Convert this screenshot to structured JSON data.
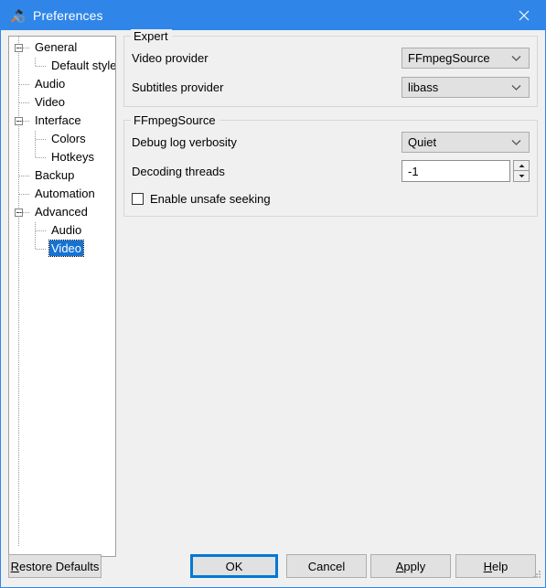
{
  "window": {
    "title": "Preferences",
    "icon": "hammer-wrench-icon",
    "close_label": "✕",
    "titlebar_color": "#2f86e8",
    "background_color": "#f0f0f0",
    "accent_color": "#0078d7",
    "selection_color": "#1673d4"
  },
  "sidebar": {
    "items": [
      {
        "label": "General",
        "level": 0,
        "expander": "collapse-minus",
        "selected": false
      },
      {
        "label": "Default styles",
        "level": 1,
        "expander": "none",
        "selected": false
      },
      {
        "label": "Audio",
        "level": 0,
        "expander": "none",
        "selected": false
      },
      {
        "label": "Video",
        "level": 0,
        "expander": "none",
        "selected": false
      },
      {
        "label": "Interface",
        "level": 0,
        "expander": "collapse-minus",
        "selected": false
      },
      {
        "label": "Colors",
        "level": 1,
        "expander": "none",
        "selected": false
      },
      {
        "label": "Hotkeys",
        "level": 1,
        "expander": "none",
        "selected": false
      },
      {
        "label": "Backup",
        "level": 0,
        "expander": "none",
        "selected": false
      },
      {
        "label": "Automation",
        "level": 0,
        "expander": "none",
        "selected": false
      },
      {
        "label": "Advanced",
        "level": 0,
        "expander": "collapse-minus",
        "selected": false
      },
      {
        "label": "Audio",
        "level": 1,
        "expander": "none",
        "selected": false
      },
      {
        "label": "Video",
        "level": 1,
        "expander": "none",
        "selected": true
      }
    ]
  },
  "main": {
    "groups": [
      {
        "title": "Expert",
        "rows": [
          {
            "label": "Video provider",
            "control": "combo",
            "value": "FFmpegSource"
          },
          {
            "label": "Subtitles provider",
            "control": "combo",
            "value": "libass"
          }
        ]
      },
      {
        "title": "FFmpegSource",
        "rows": [
          {
            "label": "Debug log verbosity",
            "control": "combo",
            "value": "Quiet"
          },
          {
            "label": "Decoding threads",
            "control": "spinner",
            "value": "-1"
          }
        ],
        "checkbox": {
          "label": "Enable unsafe seeking",
          "checked": false
        }
      }
    ]
  },
  "footer": {
    "buttons": [
      {
        "id": "restore",
        "label": "Restore Defaults",
        "mnemonic": "R",
        "default": false
      },
      {
        "id": "ok",
        "label": "OK",
        "mnemonic": "",
        "default": true
      },
      {
        "id": "cancel",
        "label": "Cancel",
        "mnemonic": "",
        "default": false
      },
      {
        "id": "apply",
        "label": "Apply",
        "mnemonic": "A",
        "default": false
      },
      {
        "id": "help",
        "label": "Help",
        "mnemonic": "H",
        "default": false
      }
    ]
  }
}
